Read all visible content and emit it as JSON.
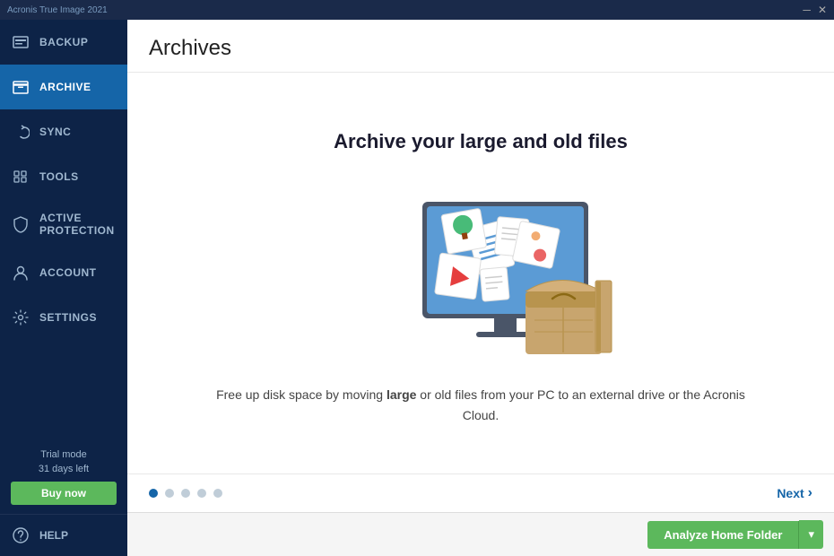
{
  "topbar": {
    "logo": "Acronis True Image 2021"
  },
  "sidebar": {
    "items": [
      {
        "id": "backup",
        "label": "Backup",
        "icon": "backup-icon",
        "active": false
      },
      {
        "id": "archive",
        "label": "Archive",
        "icon": "archive-icon",
        "active": true
      },
      {
        "id": "sync",
        "label": "Sync",
        "icon": "sync-icon",
        "active": false
      },
      {
        "id": "tools",
        "label": "Tools",
        "icon": "tools-icon",
        "active": false
      },
      {
        "id": "active-protection",
        "label": "Active Protection",
        "icon": "shield-icon",
        "active": false
      },
      {
        "id": "account",
        "label": "Account",
        "icon": "account-icon",
        "active": false
      },
      {
        "id": "settings",
        "label": "Settings",
        "icon": "settings-icon",
        "active": false
      }
    ],
    "trial": {
      "line1": "Trial mode",
      "line2": "31 days left",
      "buy_label": "Buy now"
    },
    "help": {
      "label": "Help",
      "icon": "help-icon"
    }
  },
  "content": {
    "page_title": "Archives",
    "headline": "Archive your large and old files",
    "description": "Free up disk space by moving large or old files from your PC to an external drive or the Acronis Cloud.",
    "dots": [
      {
        "active": true
      },
      {
        "active": false
      },
      {
        "active": false
      },
      {
        "active": false
      },
      {
        "active": false
      }
    ],
    "next_label": "Next",
    "analyze_label": "Analyze Home Folder"
  }
}
